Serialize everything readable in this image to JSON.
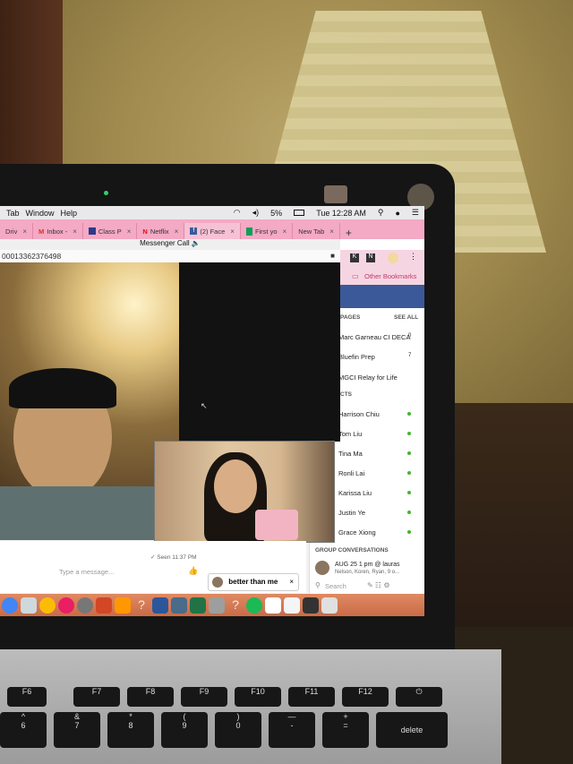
{
  "menubar": {
    "items": [
      "Tab",
      "Window",
      "Help"
    ],
    "battery": "5%",
    "clock": "Tue 12:28 AM"
  },
  "tabs": [
    {
      "label": "Driv",
      "icon": "drive-icon"
    },
    {
      "label": "Inbox -",
      "icon": "gmail-icon"
    },
    {
      "label": "Class P",
      "icon": "class-icon"
    },
    {
      "label": "Netflix",
      "icon": "netflix-icon"
    },
    {
      "label": "(2) Face",
      "icon": "facebook-icon",
      "active": true
    },
    {
      "label": "First yo",
      "icon": "sheets-icon"
    },
    {
      "label": "New Tab",
      "icon": ""
    }
  ],
  "window": {
    "title": "Messenger Call",
    "url": "00013362376498"
  },
  "facebook": {
    "other_bookmarks": "Other Bookmarks",
    "pages_header": "PAGES",
    "see_all": "SEE ALL",
    "pages": [
      {
        "name": "Marc Garneau CI DECA",
        "badge": "0"
      },
      {
        "name": "Bluefin Prep",
        "badge": "7"
      },
      {
        "name": "MGCI Relay for Life",
        "badge": ""
      }
    ],
    "contacts_header": "CTS",
    "contacts": [
      "Harrison Chiu",
      "Tom Liu",
      "Tina Ma",
      "Ronli Lai",
      "Karissa Liu",
      "Justin Ye",
      "Grace Xiong"
    ],
    "group_header": "GROUP CONVERSATIONS",
    "group": {
      "title": "AUG 25 1 pm @ lauras",
      "members": "Nelson, Koren, Ryan, 9 o..."
    },
    "search_placeholder": "Search"
  },
  "chat": {
    "seen": "✓ Seen 11:37 PM",
    "placeholder": "Type a message...",
    "mini_chat": "better than me"
  },
  "keyboard": {
    "fkeys": [
      "F6",
      "F7",
      "F8",
      "F9",
      "F10",
      "F11",
      "F12"
    ],
    "numbers": [
      {
        "top": "^",
        "bottom": "6"
      },
      {
        "top": "&",
        "bottom": "7"
      },
      {
        "top": "*",
        "bottom": "8"
      },
      {
        "top": "(",
        "bottom": "9"
      },
      {
        "top": ")",
        "bottom": "0"
      },
      {
        "top": "—",
        "bottom": "-"
      },
      {
        "top": "+",
        "bottom": "="
      }
    ],
    "delete": "delete"
  },
  "colors": {
    "tabbar": "#f4a9c4",
    "facebook_blue": "#3b5998",
    "online": "#42b72a"
  }
}
